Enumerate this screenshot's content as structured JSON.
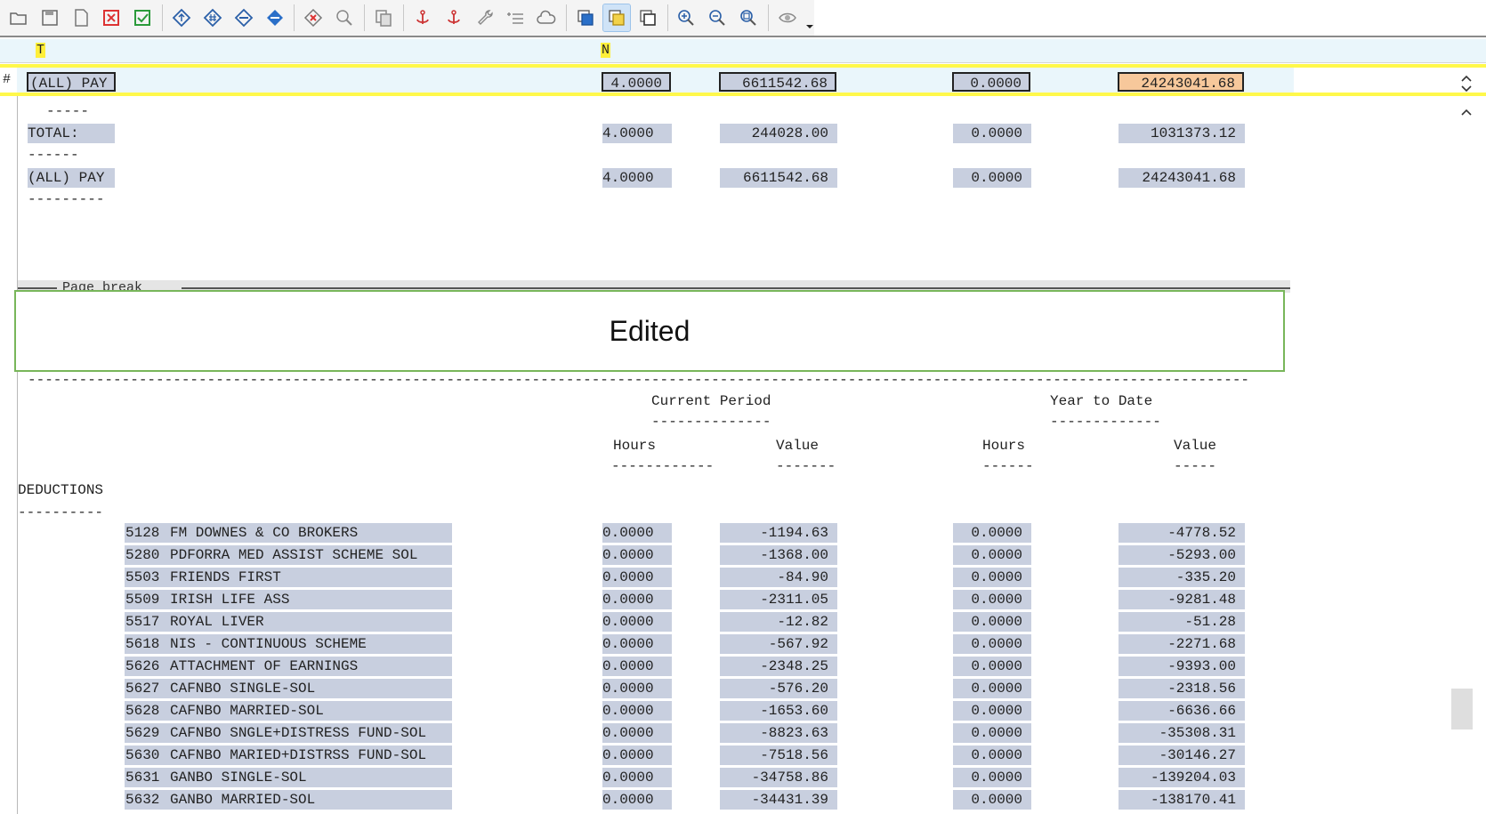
{
  "toolbar": {
    "icons": [
      "open-folder-icon",
      "save-icon",
      "new-page-icon",
      "delete-red-icon",
      "check-green-icon",
      "diamond-up-icon",
      "diamond-hash-icon",
      "diamond-minus-icon",
      "diamond-blue-icon",
      "diamond-x-icon",
      "zoom-page-icon",
      "copy-page-icon",
      "anchor-red-icon",
      "anchor-red2-icon",
      "wrench-icon",
      "list-add-icon",
      "cloud-icon",
      "blue-square-icon",
      "yellow-square-icon",
      "outline-square-icon",
      "zoom-in-icon",
      "zoom-out-icon",
      "zoom-fit-icon",
      "eye-icon",
      "dropdown-arrow-icon"
    ]
  },
  "tagline": {
    "tag_t": "T",
    "tag_n": "N"
  },
  "selected_row": {
    "hash": "#",
    "label": "(ALL) PAY",
    "hours_cp": "4.0000",
    "value_cp": "6611542.68",
    "hours_ytd": "0.0000",
    "value_ytd": "24243041.68"
  },
  "report": {
    "dash1": "-----",
    "total": {
      "label": "TOTAL:",
      "hours_cp": "4.0000",
      "value_cp": "244028.00",
      "hours_ytd": "0.0000",
      "value_ytd": "1031373.12"
    },
    "dash2": "------",
    "allpay": {
      "label": "(ALL) PAY",
      "hours_cp": "4.0000",
      "value_cp": "6611542.68",
      "hours_ytd": "0.0000",
      "value_ytd": "24243041.68"
    },
    "dash3": "---------",
    "page_break": "Page break",
    "edited": "Edited",
    "long_dash": "-----------------------------------------------------------------------------------------------------------------------------------------------",
    "current_period": "Current Period",
    "current_period_dash": "--------------",
    "year_to_date": "Year to Date",
    "year_to_date_dash": "-------------",
    "hours1": "Hours",
    "hours1_dash": "------------",
    "value1": "Value",
    "value1_dash": "-------",
    "hours2": "Hours",
    "hours2_dash": "------",
    "value2": "Value",
    "value2_dash": "-----",
    "deductions": "DEDUCTIONS",
    "deductions_dash": "----------",
    "rows": [
      {
        "code": "5128",
        "name": "FM DOWNES & CO BROKERS",
        "hours_cp": "0.0000",
        "value_cp": "-1194.63",
        "hours_ytd": "0.0000",
        "value_ytd": "-4778.52"
      },
      {
        "code": "5280",
        "name": "PDFORRA MED ASSIST SCHEME SOL",
        "hours_cp": "0.0000",
        "value_cp": "-1368.00",
        "hours_ytd": "0.0000",
        "value_ytd": "-5293.00"
      },
      {
        "code": "5503",
        "name": "FRIENDS FIRST",
        "hours_cp": "0.0000",
        "value_cp": "-84.90",
        "hours_ytd": "0.0000",
        "value_ytd": "-335.20"
      },
      {
        "code": "5509",
        "name": "IRISH LIFE ASS",
        "hours_cp": "0.0000",
        "value_cp": "-2311.05",
        "hours_ytd": "0.0000",
        "value_ytd": "-9281.48"
      },
      {
        "code": "5517",
        "name": "ROYAL LIVER",
        "hours_cp": "0.0000",
        "value_cp": "-12.82",
        "hours_ytd": "0.0000",
        "value_ytd": "-51.28"
      },
      {
        "code": "5618",
        "name": "NIS - CONTINUOUS SCHEME",
        "hours_cp": "0.0000",
        "value_cp": "-567.92",
        "hours_ytd": "0.0000",
        "value_ytd": "-2271.68"
      },
      {
        "code": "5626",
        "name": "ATTACHMENT OF EARNINGS",
        "hours_cp": "0.0000",
        "value_cp": "-2348.25",
        "hours_ytd": "0.0000",
        "value_ytd": "-9393.00"
      },
      {
        "code": "5627",
        "name": "CAFNBO SINGLE-SOL",
        "hours_cp": "0.0000",
        "value_cp": "-576.20",
        "hours_ytd": "0.0000",
        "value_ytd": "-2318.56"
      },
      {
        "code": "5628",
        "name": "CAFNBO MARRIED-SOL",
        "hours_cp": "0.0000",
        "value_cp": "-1653.60",
        "hours_ytd": "0.0000",
        "value_ytd": "-6636.66"
      },
      {
        "code": "5629",
        "name": "CAFNBO SNGLE+DISTRESS FUND-SOL",
        "hours_cp": "0.0000",
        "value_cp": "-8823.63",
        "hours_ytd": "0.0000",
        "value_ytd": "-35308.31"
      },
      {
        "code": "5630",
        "name": "CAFNBO MARIED+DISTRSS FUND-SOL",
        "hours_cp": "0.0000",
        "value_cp": "-7518.56",
        "hours_ytd": "0.0000",
        "value_ytd": "-30146.27"
      },
      {
        "code": "5631",
        "name": "GANBO SINGLE-SOL",
        "hours_cp": "0.0000",
        "value_cp": "-34758.86",
        "hours_ytd": "0.0000",
        "value_ytd": "-139204.03"
      },
      {
        "code": "5632",
        "name": "GANBO MARRIED-SOL",
        "hours_cp": "0.0000",
        "value_cp": "-34431.39",
        "hours_ytd": "0.0000",
        "value_ytd": "-138170.41"
      }
    ]
  }
}
